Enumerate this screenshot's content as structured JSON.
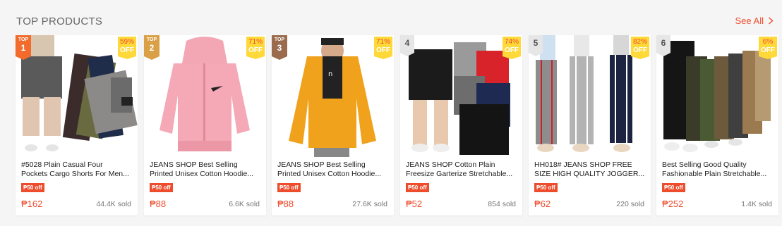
{
  "section": {
    "title": "TOP PRODUCTS",
    "see_all": "See All"
  },
  "rank_top_label": "TOP",
  "products": [
    {
      "rank": "1",
      "discount": "59%",
      "off": "OFF",
      "name_line1": "#5028 Plain Casual Four",
      "name_line2": "Pockets Cargo Shorts For Men...",
      "voucher": "₱50 off",
      "price": "₱162",
      "sold": "44.4K sold"
    },
    {
      "rank": "2",
      "discount": "71%",
      "off": "OFF",
      "name_line1": "JEANS SHOP Best Selling",
      "name_line2": "Printed Unisex Cotton Hoodie...",
      "voucher": "₱50 off",
      "price": "₱88",
      "sold": "6.6K sold"
    },
    {
      "rank": "3",
      "discount": "71%",
      "off": "OFF",
      "name_line1": "JEANS SHOP Best Selling",
      "name_line2": "Printed Unisex Cotton Hoodie...",
      "voucher": "₱50 off",
      "price": "₱88",
      "sold": "27.6K sold"
    },
    {
      "rank": "4",
      "discount": "74%",
      "off": "OFF",
      "name_line1": "JEANS SHOP Cotton Plain",
      "name_line2": "Freesize Garterize Stretchable...",
      "voucher": "₱50 off",
      "price": "₱52",
      "sold": "854 sold"
    },
    {
      "rank": "5",
      "discount": "82%",
      "off": "OFF",
      "name_line1": "HH018# JEANS SHOP FREE",
      "name_line2": "SIZE HIGH QUALITY JOGGER...",
      "voucher": "₱50 off",
      "price": "₱62",
      "sold": "220 sold"
    },
    {
      "rank": "6",
      "discount": "6%",
      "off": "OFF",
      "name_line1": "Best Selling Good Quality",
      "name_line2": "Fashionable Plain Stretchable...",
      "voucher": "₱50 off",
      "price": "₱252",
      "sold": "1.4K sold"
    }
  ],
  "colors": {
    "accent": "#ee4d2d",
    "badge_yellow": "#ffd839"
  }
}
